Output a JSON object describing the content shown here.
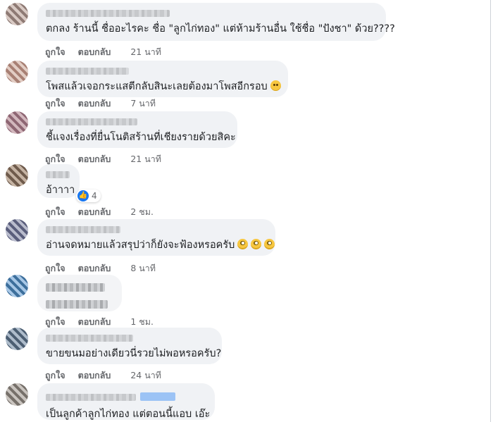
{
  "actions": {
    "like": "ถูกใจ",
    "reply": "ตอบกลับ"
  },
  "comments": [
    {
      "text": "ตกลง ร้านนี้ ชื่ออะไรคะ ชื่อ \"ลูกไก่ทอง\" แต่ห้ามร้านอื่น ใช้ชื่อ \"ปังชา\" ด้วย????",
      "time": "21 นาที"
    },
    {
      "text": "โพสแล้วเจอกระแสตีกลับสินะเลยต้องมาโพสอีกรอบ",
      "time": "7 นาที",
      "emoji": "slightly-smiling-face"
    },
    {
      "text": "ชี้แจงเรื่องที่ยื่นโนติสร้านที่เชียงรายด้วยสิคะ",
      "time": "21 นาที"
    },
    {
      "text": "อ้าาาา",
      "time": "2 ชม.",
      "reaction_count": "4",
      "reaction_icon": "like-icon"
    },
    {
      "text": "อ่านจดหมายแล้วสรุปว่าก็ยังจะฟ้องหรอครับ",
      "time": "8 นาที",
      "emoji": "face-with-rolling-eyes"
    },
    {
      "text": "",
      "time": "1 ชม."
    },
    {
      "text": "ขายขนมอย่างเดียวนี่รวยไม่พอหรอครับ?",
      "time": "24 นาที"
    },
    {
      "text": "เป็นลูกค้าลูกไก่ทอง แต่ตอนนี้แอบ เอ๊ะ",
      "time": ""
    }
  ]
}
